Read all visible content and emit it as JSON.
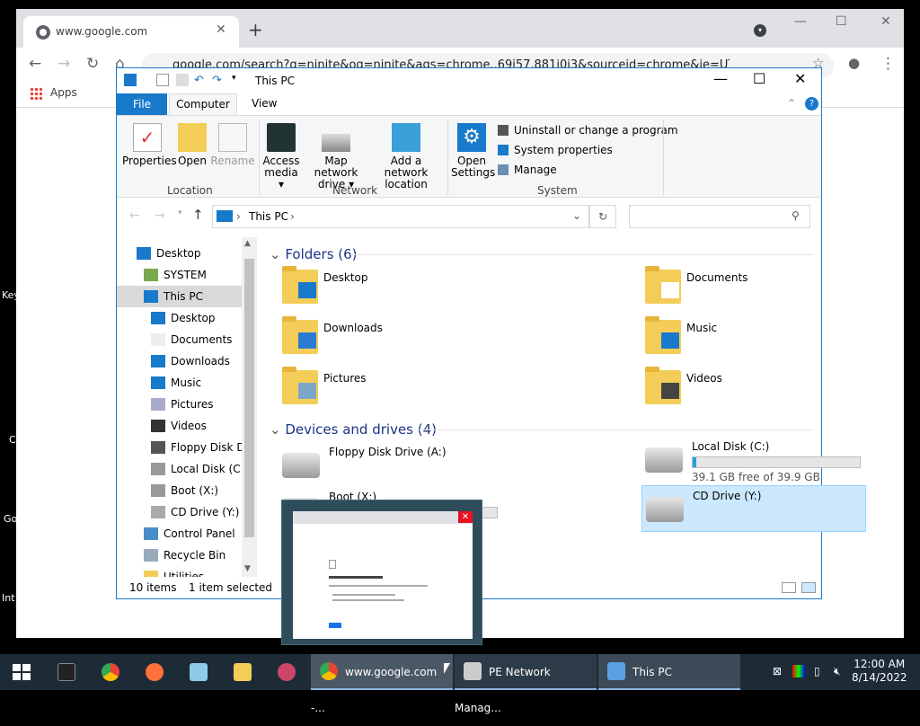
{
  "desktop": {
    "labels": [
      "Key",
      "C",
      "Go",
      "Int"
    ]
  },
  "chrome": {
    "tab_title": "www.google.com",
    "url": "google.com/search?q=ninite&oq=ninite&aqs=chrome..69i57.881j0j3&sourceid=chrome&ie=UTF-8",
    "bookmarks_apps": "Apps"
  },
  "explorer": {
    "title": "This PC",
    "tabs": {
      "file": "File",
      "computer": "Computer",
      "view": "View"
    },
    "ribbon": {
      "location": {
        "label": "Location",
        "buttons": [
          "Properties",
          "Open",
          "Rename"
        ]
      },
      "network": {
        "label": "Network",
        "access_media": [
          "Access",
          "media ▾"
        ],
        "map_drive": [
          "Map network",
          "drive ▾"
        ],
        "add_location": [
          "Add a network",
          "location"
        ]
      },
      "system": {
        "label": "System",
        "open_settings": [
          "Open",
          "Settings"
        ],
        "uninstall": "Uninstall or change a program",
        "system_properties": "System properties",
        "manage": "Manage"
      }
    },
    "address": {
      "path": "This PC"
    },
    "tree": [
      "Desktop",
      "SYSTEM",
      "This PC",
      "Desktop",
      "Documents",
      "Downloads",
      "Music",
      "Pictures",
      "Videos",
      "Floppy Disk Dri",
      "Local Disk (C:)",
      "Boot (X:)",
      "CD Drive (Y:)",
      "Control Panel",
      "Recycle Bin",
      "Utilities"
    ],
    "folders_header": "Folders (6)",
    "folders": [
      "Desktop",
      "Documents",
      "Downloads",
      "Music",
      "Pictures",
      "Videos"
    ],
    "drives_header": "Devices and drives (4)",
    "drives": {
      "floppy": "Floppy Disk Drive (A:)",
      "local": "Local Disk (C:)",
      "local_free": "39.1 GB free of 39.9 GB",
      "local_used_fraction": 0.02,
      "boot": "Boot (X:)",
      "cd": "CD Drive (Y:)"
    },
    "status": {
      "items": "10 items",
      "selected": "1 item selected"
    }
  },
  "taskbar": {
    "tasks": [
      "www.google.com -...",
      "PE Network Manag...",
      "This PC"
    ],
    "time": "12:00 AM",
    "date": "8/14/2022"
  },
  "colors": {
    "accent": "#1979ca",
    "selection": "#cce8ff",
    "taskbar": "#1d2b37"
  }
}
